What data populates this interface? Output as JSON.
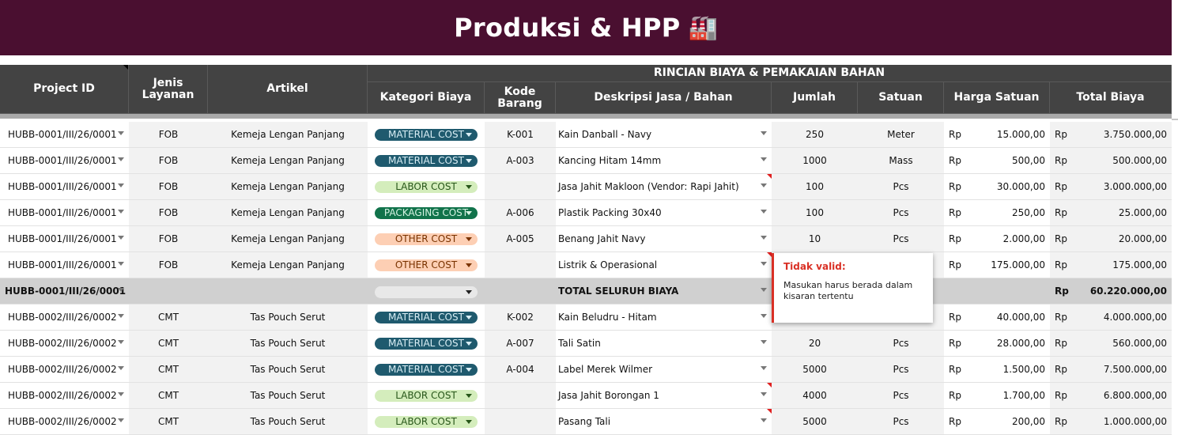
{
  "banner": {
    "title": "Produksi & HPP",
    "icon": "factory-icon"
  },
  "headers": {
    "project_id": "Project ID",
    "jenis_layanan": "Jenis Layanan",
    "artikel": "Artikel",
    "group": "RINCIAN BIAYA & PEMAKAIAN BAHAN",
    "kategori_biaya": "Kategori Biaya",
    "kode_barang": "Kode Barang",
    "deskripsi": "Deskripsi Jasa / Bahan",
    "jumlah": "Jumlah",
    "satuan": "Satuan",
    "harga_satuan": "Harga Satuan",
    "total_biaya": "Total Biaya"
  },
  "currency": "Rp",
  "colors": {
    "banner": "#4a0f30",
    "header": "#434343",
    "material": "#1f5a6e",
    "labor": "#d4edbc",
    "packaging": "#11734b",
    "other": "#fdcfb4",
    "error": "#d93025"
  },
  "rows": [
    {
      "project_id": "HUBB-0001/III/26/0001",
      "jenis": "FOB",
      "artikel": "Kemeja Lengan Panjang",
      "kategori": "MATERIAL COST",
      "kat_type": "material",
      "kode": "K-001",
      "deskripsi": "Kain Danball - Navy",
      "jumlah": "250",
      "satuan": "Meter",
      "harga": "15.000,00",
      "total": "3.750.000,00",
      "note": false
    },
    {
      "project_id": "HUBB-0001/III/26/0001",
      "jenis": "FOB",
      "artikel": "Kemeja Lengan Panjang",
      "kategori": "MATERIAL COST",
      "kat_type": "material",
      "kode": "A-003",
      "deskripsi": "Kancing Hitam 14mm",
      "jumlah": "1000",
      "satuan": "Mass",
      "harga": "500,00",
      "total": "500.000,00",
      "note": false
    },
    {
      "project_id": "HUBB-0001/III/26/0001",
      "jenis": "FOB",
      "artikel": "Kemeja Lengan Panjang",
      "kategori": "LABOR COST",
      "kat_type": "labor",
      "kode": "",
      "deskripsi": "Jasa Jahit Makloon (Vendor: Rapi Jahit)",
      "jumlah": "100",
      "satuan": "Pcs",
      "harga": "30.000,00",
      "total": "3.000.000,00",
      "note": true
    },
    {
      "project_id": "HUBB-0001/III/26/0001",
      "jenis": "FOB",
      "artikel": "Kemeja Lengan Panjang",
      "kategori": "PACKAGING COST",
      "kat_type": "packaging",
      "kode": "A-006",
      "deskripsi": "Plastik Packing 30x40",
      "jumlah": "100",
      "satuan": "Pcs",
      "harga": "250,00",
      "total": "25.000,00",
      "note": false
    },
    {
      "project_id": "HUBB-0001/III/26/0001",
      "jenis": "FOB",
      "artikel": "Kemeja Lengan Panjang",
      "kategori": "OTHER COST",
      "kat_type": "other",
      "kode": "A-005",
      "deskripsi": "Benang Jahit Navy",
      "jumlah": "10",
      "satuan": "Pcs",
      "harga": "2.000,00",
      "total": "20.000,00",
      "note": false
    },
    {
      "project_id": "HUBB-0001/III/26/0001",
      "jenis": "FOB",
      "artikel": "Kemeja Lengan Panjang",
      "kategori": "OTHER COST",
      "kat_type": "other",
      "kode": "",
      "deskripsi": "Listrik & Operasional",
      "jumlah": "",
      "satuan": "",
      "harga": "175.000,00",
      "total": "175.000,00",
      "note": true
    },
    {
      "project_id": "HUBB-0001/III/26/0001",
      "jenis": "",
      "artikel": "",
      "kategori": "",
      "kat_type": "empty",
      "kode": "",
      "deskripsi": "TOTAL SELURUH BIAYA",
      "jumlah": "",
      "satuan": "",
      "harga": "",
      "total": "60.220.000,00",
      "note": false,
      "is_total": true
    },
    {
      "project_id": "HUBB-0002/III/26/0002",
      "jenis": "CMT",
      "artikel": "Tas Pouch Serut",
      "kategori": "MATERIAL COST",
      "kat_type": "material",
      "kode": "K-002",
      "deskripsi": "Kain Beludru - Hitam",
      "jumlah": "",
      "satuan": "",
      "harga": "40.000,00",
      "total": "4.000.000,00",
      "note": false
    },
    {
      "project_id": "HUBB-0002/III/26/0002",
      "jenis": "CMT",
      "artikel": "Tas Pouch Serut",
      "kategori": "MATERIAL COST",
      "kat_type": "material",
      "kode": "A-007",
      "deskripsi": "Tali Satin",
      "jumlah": "20",
      "satuan": "Pcs",
      "harga": "28.000,00",
      "total": "560.000,00",
      "note": false
    },
    {
      "project_id": "HUBB-0002/III/26/0002",
      "jenis": "CMT",
      "artikel": "Tas Pouch Serut",
      "kategori": "MATERIAL COST",
      "kat_type": "material",
      "kode": "A-004",
      "deskripsi": "Label Merek Wilmer",
      "jumlah": "5000",
      "satuan": "Pcs",
      "harga": "1.500,00",
      "total": "7.500.000,00",
      "note": false
    },
    {
      "project_id": "HUBB-0002/III/26/0002",
      "jenis": "CMT",
      "artikel": "Tas Pouch Serut",
      "kategori": "LABOR COST",
      "kat_type": "labor",
      "kode": "",
      "deskripsi": "Jasa Jahit Borongan 1",
      "jumlah": "4000",
      "satuan": "Pcs",
      "harga": "1.700,00",
      "total": "6.800.000,00",
      "note": true
    },
    {
      "project_id": "HUBB-0002/III/26/0002",
      "jenis": "CMT",
      "artikel": "Tas Pouch Serut",
      "kategori": "LABOR COST",
      "kat_type": "labor",
      "kode": "",
      "deskripsi": "Pasang Tali",
      "jumlah": "5000",
      "satuan": "Pcs",
      "harga": "200,00",
      "total": "1.000.000,00",
      "note": true
    }
  ],
  "tooltip": {
    "title": "Tidak valid:",
    "message": "Masukan harus berada dalam kisaran tertentu"
  }
}
